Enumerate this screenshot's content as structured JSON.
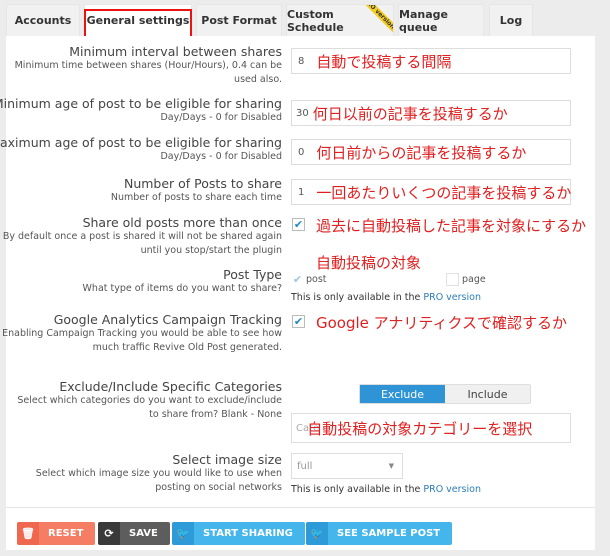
{
  "tabs": [
    {
      "label": "Accounts",
      "active": false
    },
    {
      "label": "General settings",
      "active": true
    },
    {
      "label": "Post Format",
      "active": false
    },
    {
      "label": "Custom Schedule",
      "active": false,
      "ribbon": "PRO version"
    },
    {
      "label": "Manage queue",
      "active": false
    },
    {
      "label": "Log",
      "active": false
    }
  ],
  "settings": {
    "min_interval": {
      "title": "Minimum interval between shares",
      "desc": "Minimum time between shares (Hour/Hours), 0.4 can be used also.",
      "value": "8",
      "annotation": "自動で投稿する間隔"
    },
    "min_age": {
      "title": "Minimum age of post to be eligible for sharing",
      "desc": "Day/Days - 0 for Disabled",
      "value": "30",
      "annotation": "何日以前の記事を投稿するか"
    },
    "max_age": {
      "title": "Maximum age of post to be eligible for sharing",
      "desc": "Day/Days - 0 for Disabled",
      "value": "0",
      "annotation": "何日前からの記事を投稿するか"
    },
    "num_posts": {
      "title": "Number of Posts to share",
      "desc": "Number of posts to share each time",
      "value": "1",
      "annotation": "一回あたりいくつの記事を投稿するか"
    },
    "share_more_once": {
      "title": "Share old posts more than once",
      "desc": "By default once a post is shared it will not be shared again until you stop/start the plugin",
      "checked": true,
      "annotation": "過去に自動投稿した記事を対象にするか"
    },
    "post_type": {
      "title": "Post Type",
      "desc": "What type of items do you want to share?",
      "annotation": "自動投稿の対象",
      "options": [
        {
          "label": "post",
          "checked": true
        },
        {
          "label": "page",
          "checked": false
        }
      ],
      "pro_note": "This is only available in the",
      "pro_link": "PRO version"
    },
    "ga_tracking": {
      "title": "Google Analytics Campaign Tracking",
      "desc": "Enabling Campaign Tracking you would be able to see how much traffic Revive Old Post generated.",
      "checked": true,
      "annotation": "Google アナリティクスで確認するか"
    },
    "categories": {
      "title": "Exclude/Include Specific Categories",
      "desc": "Select which categories do you want to exclude/include to share from? Blank - None",
      "toggle_on": "Exclude",
      "toggle_off": "Include",
      "placeholder": "Cate",
      "annotation": "自動投稿の対象カテゴリーを選択"
    },
    "image_size": {
      "title": "Select image size",
      "desc": "Select which image size you would like to use when posting on social networks",
      "value": "full",
      "pro_note": "This is only available in the",
      "pro_link": "PRO version"
    }
  },
  "buttons": {
    "reset": "RESET",
    "save": "SAVE",
    "start_sharing": "START SHARING",
    "sample_post": "SEE SAMPLE POST"
  },
  "colors": {
    "accent_blue": "#2e94d6",
    "annotation_red": "#e02020",
    "reset": "#f47d64",
    "save": "#5d5d5d",
    "twitter": "#44b6ec"
  }
}
